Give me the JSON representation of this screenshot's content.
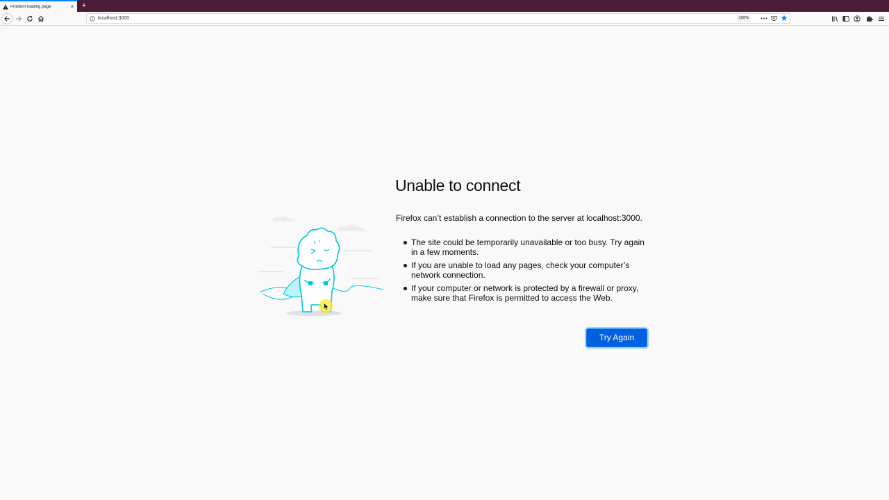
{
  "browser": {
    "tab": {
      "title": "Problem loading page",
      "close_symbol": "×"
    },
    "new_tab_symbol": "+",
    "url": "localhost:3000",
    "zoom": "150%",
    "colors": {
      "tab_strip": "#4a1d35",
      "accent": "#0a84ff",
      "button": "#0060df"
    }
  },
  "error": {
    "title": "Unable to connect",
    "description": "Firefox can’t establish a connection to the server at localhost:3000.",
    "bullets": [
      "The site could be temporarily unavailable or too busy. Try again in a few moments.",
      "If you are unable to load any pages, check your computer’s network connection.",
      "If your computer or network is protected by a firewall or proxy, make sure that Firefox is permitted to access the Web."
    ],
    "button_label": "Try Again"
  },
  "icons": {
    "tab": "warning-icon",
    "nav": [
      "back-icon",
      "forward-icon",
      "reload-icon",
      "home-icon"
    ],
    "urlbar": [
      "info-icon",
      "page-actions-icon",
      "pocket-icon",
      "bookmark-star-icon"
    ],
    "toolbar": [
      "library-icon",
      "sidebar-icon",
      "account-icon",
      "extension-icon",
      "menu-icon"
    ]
  }
}
